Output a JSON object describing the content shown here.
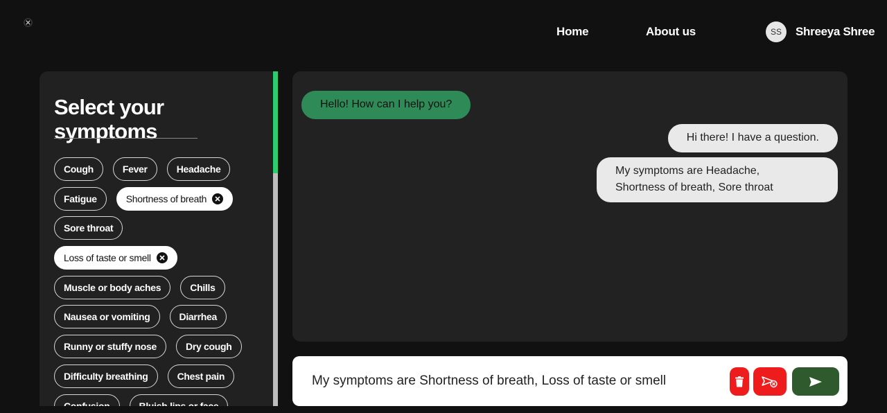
{
  "nav": {
    "home": "Home",
    "about": "About us",
    "avatar_initials": "SS",
    "user_name": "Shreeya Shree"
  },
  "symptoms": {
    "title_line1": "Select your",
    "title_line2": "symptoms",
    "rows": [
      [
        {
          "label": "Cough",
          "selected": false
        },
        {
          "label": "Fever",
          "selected": false
        },
        {
          "label": "Headache",
          "selected": false
        }
      ],
      [
        {
          "label": "Fatigue",
          "selected": false
        },
        {
          "label": "Shortness of breath",
          "selected": true
        }
      ],
      [
        {
          "label": "Sore throat",
          "selected": false
        }
      ],
      [
        {
          "label": "Loss of taste or smell",
          "selected": true
        }
      ],
      [
        {
          "label": "Muscle or body aches",
          "selected": false
        },
        {
          "label": "Chills",
          "selected": false
        }
      ],
      [
        {
          "label": "Nausea or vomiting",
          "selected": false
        },
        {
          "label": "Diarrhea",
          "selected": false
        }
      ],
      [
        {
          "label": "Runny or stuffy nose",
          "selected": false
        },
        {
          "label": "Dry cough",
          "selected": false
        }
      ],
      [
        {
          "label": "Difficulty breathing",
          "selected": false
        },
        {
          "label": "Chest pain",
          "selected": false
        }
      ],
      [
        {
          "label": "Confusion",
          "selected": false
        },
        {
          "label": "Bluish lips or face",
          "selected": false
        }
      ]
    ]
  },
  "chat": {
    "bot_message": "Hello! How can I help you?",
    "user_message_1": "Hi there! I have a question.",
    "user_message_2_line1": "My symptoms are Headache,",
    "user_message_2_line2": "Shortness of breath, Sore throat"
  },
  "input": {
    "value": "My symptoms are Shortness of breath, Loss of taste or smell"
  },
  "colors": {
    "accent_green": "#2e8b57",
    "send_green": "#2e5a2e",
    "danger_red": "#ee1c1c",
    "scroll_green": "#2ecc71"
  },
  "icons": {
    "corner": "close-circle-icon",
    "delete": "trash-icon",
    "cancel": "cancel-send-icon",
    "send": "send-icon"
  }
}
